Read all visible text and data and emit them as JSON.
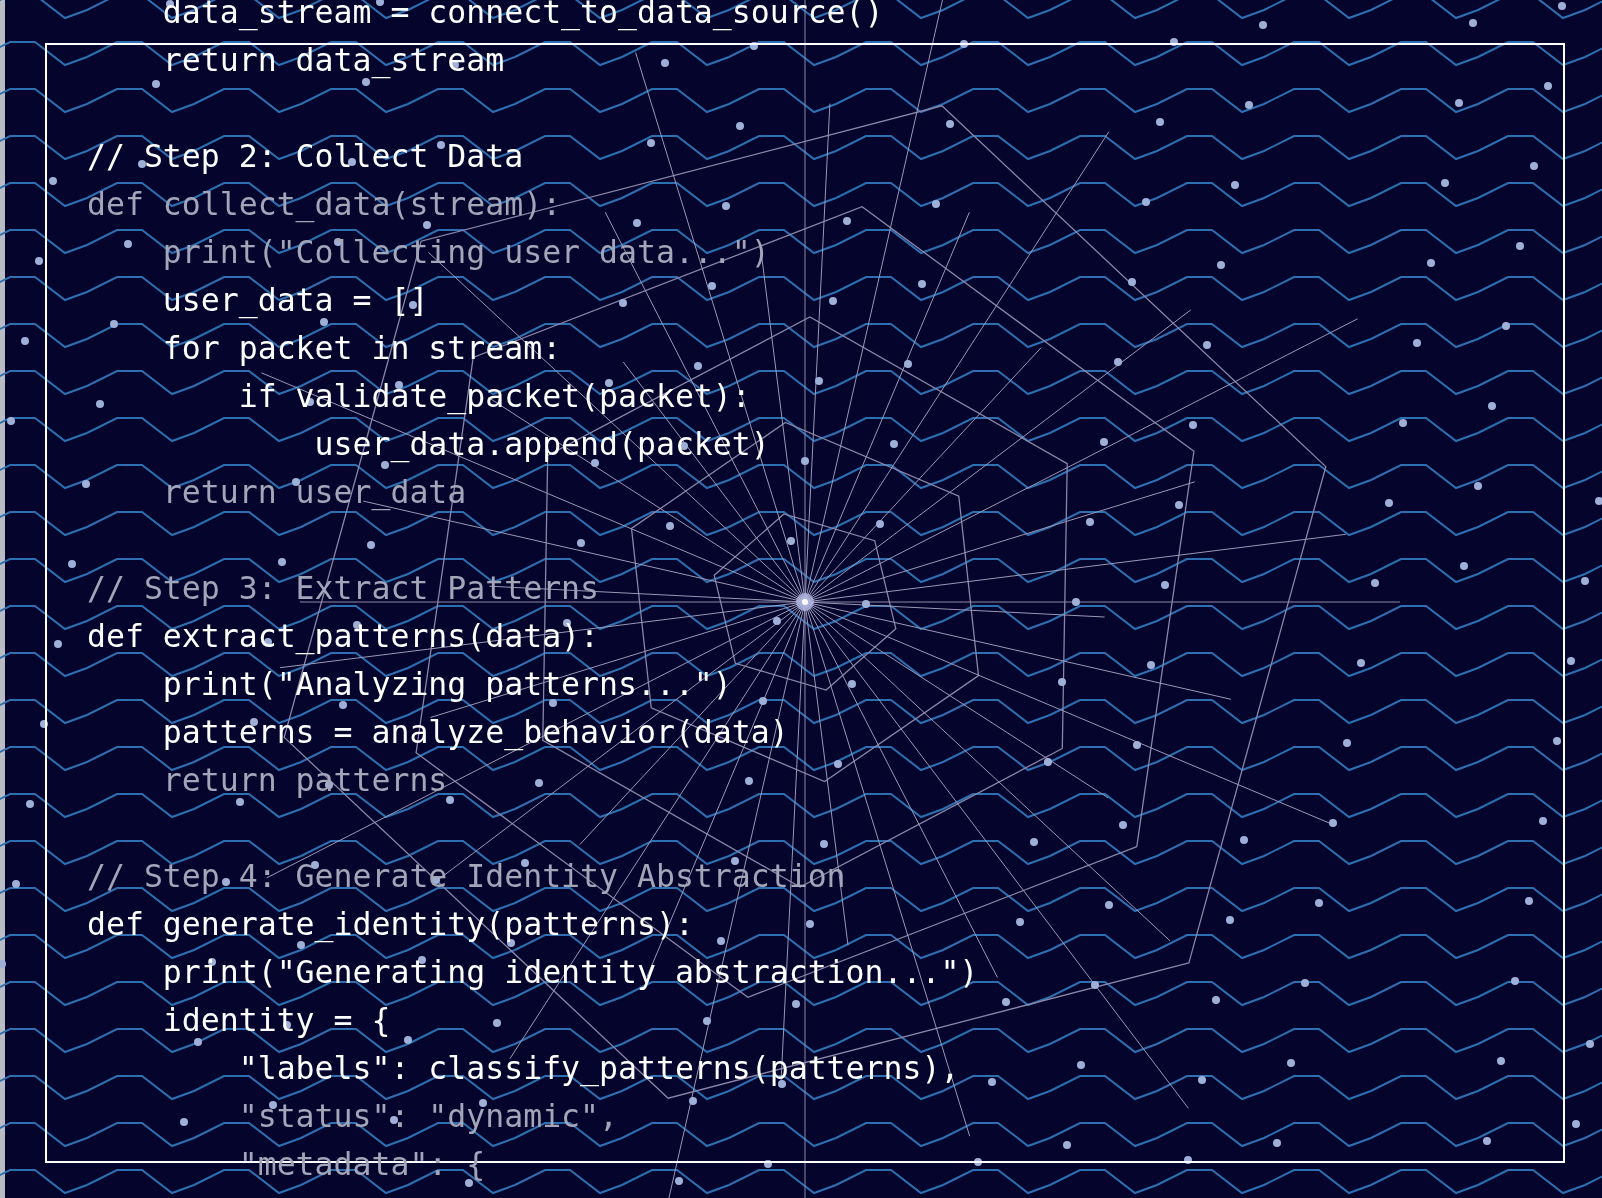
{
  "code_blocks": [
    {
      "lines": [
        {
          "text": "    data_stream = connect_to_data_source()",
          "dim": false
        },
        {
          "text": "    return data_stream",
          "dim": false
        }
      ]
    },
    {
      "lines": [
        {
          "text": "// Step 2: Collect Data",
          "dim": false
        },
        {
          "text": "def collect_data(stream):",
          "dim": true
        },
        {
          "text": "    print(\"Collecting user data...\")",
          "dim": true
        },
        {
          "text": "    user_data = []",
          "dim": false
        },
        {
          "text": "    for packet in stream:",
          "dim": false
        },
        {
          "text": "        if validate_packet(packet):",
          "dim": false
        },
        {
          "text": "            user_data.append(packet)",
          "dim": false
        },
        {
          "text": "    return user_data",
          "dim": true
        }
      ]
    },
    {
      "lines": [
        {
          "text": "// Step 3: Extract Patterns",
          "dim": true
        },
        {
          "text": "def extract_patterns(data):",
          "dim": false
        },
        {
          "text": "    print(\"Analyzing patterns...\")",
          "dim": false
        },
        {
          "text": "    patterns = analyze_behavior(data)",
          "dim": false
        },
        {
          "text": "    return patterns",
          "dim": true
        }
      ]
    },
    {
      "lines": [
        {
          "text": "// Step 4: Generate Identity Abstraction",
          "dim": true
        },
        {
          "text": "def generate_identity(patterns):",
          "dim": false
        },
        {
          "text": "    print(\"Generating identity abstraction...\")",
          "dim": false
        },
        {
          "text": "    identity = {",
          "dim": false
        },
        {
          "text": "        \"labels\": classify_patterns(patterns),",
          "dim": false
        },
        {
          "text": "        \"status\": \"dynamic\",",
          "dim": true
        },
        {
          "text": "        \"metadata\": {",
          "dim": true
        }
      ]
    }
  ]
}
